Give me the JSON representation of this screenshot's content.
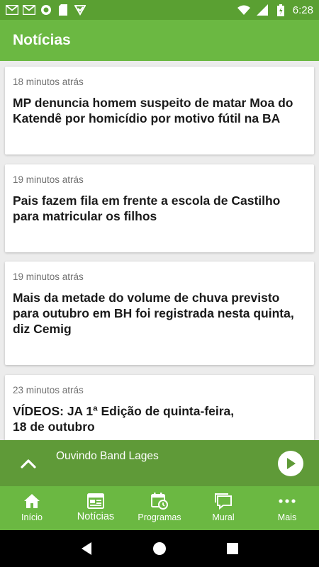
{
  "status_bar": {
    "time": "6:28",
    "icons_left": [
      "gmail-icon",
      "gmail-icon",
      "circle-app-icon",
      "sd-card-icon",
      "app-check-icon"
    ],
    "icons_right": [
      "wifi-icon",
      "signal-icon",
      "battery-icon"
    ]
  },
  "app_bar": {
    "title": "Notícias"
  },
  "articles": [
    {
      "time": "18 minutos atrás",
      "title": "MP denuncia homem suspeito de matar Moa do Katendê por homicídio por motivo fútil na BA"
    },
    {
      "time": "19 minutos atrás",
      "title": "Pais fazem fila em frente a escola de Castilho para matricular os filhos"
    },
    {
      "time": "19 minutos atrás",
      "title": "Mais da metade do volume de chuva previsto para outubro em BH foi registrada nesta quinta, diz Cemig"
    },
    {
      "time": "23 minutos atrás",
      "title": "VÍDEOS: JA 1ª Edição de quinta-feira, 18 de outubro"
    }
  ],
  "player": {
    "label": "Ouvindo Band Lages"
  },
  "bottom_nav": [
    {
      "label": "Início",
      "icon": "home-icon"
    },
    {
      "label": "Notícias",
      "icon": "news-icon",
      "active": true
    },
    {
      "label": "Programas",
      "icon": "calendar-clock-icon"
    },
    {
      "label": "Mural",
      "icon": "chat-bubbles-icon"
    },
    {
      "label": "Mais",
      "icon": "more-dots-icon"
    }
  ],
  "colors": {
    "status_bar": "#5aa032",
    "app_bar": "#6bb842",
    "player_bar": "#5f9a38",
    "accent": "#6bb842"
  }
}
